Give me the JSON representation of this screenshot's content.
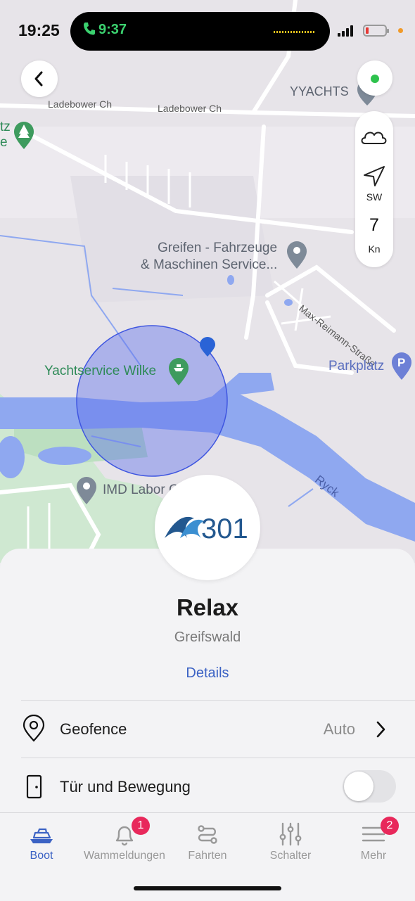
{
  "status_bar": {
    "time": "19:25",
    "call_time": "9:37"
  },
  "map": {
    "streets": [
      "Ladebower Ch",
      "Ladebower Ch",
      "Max-Reimann-Straße"
    ],
    "pois": {
      "yachts": "YYACHTS",
      "greifen_line1": "Greifen - Fahrzeuge",
      "greifen_line2": "& Maschinen Service...",
      "yachtservice": "Yachtservice Wilke",
      "parkplatz": "Parkplatz",
      "imd": "IMD Labor G",
      "edge_top": "tz",
      "edge_bottom": "e"
    },
    "river_label": "Ryck",
    "wind": {
      "direction": "SW",
      "speed": "7",
      "unit": "Kn"
    }
  },
  "boat": {
    "logo_text": "301",
    "name": "Relax",
    "location": "Greifswald",
    "details_label": "Details"
  },
  "settings": [
    {
      "label": "Geofence",
      "value": "Auto"
    },
    {
      "label": "Tür und Bewegung"
    }
  ],
  "tabs": [
    {
      "label": "Boot",
      "active": true
    },
    {
      "label": "Wammeldungen",
      "badge": "1"
    },
    {
      "label": "Fahrten"
    },
    {
      "label": "Schalter"
    },
    {
      "label": "Mehr",
      "badge": "2"
    }
  ],
  "colors": {
    "accent": "#3b62c4",
    "badge": "#e8285b",
    "river": "#8fa8f0",
    "status_dot": "#2ec24d"
  }
}
